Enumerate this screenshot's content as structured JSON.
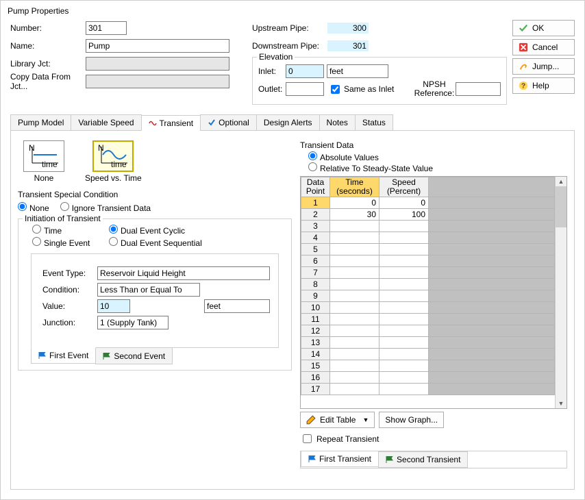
{
  "window": {
    "title": "Pump Properties"
  },
  "fields": {
    "number_label": "Number:",
    "number": "301",
    "name_label": "Name:",
    "name": "Pump",
    "library_label": "Library Jct:",
    "library": "",
    "copy_label": "Copy Data From Jct...",
    "copy": ""
  },
  "pipes": {
    "upstream_label": "Upstream Pipe:",
    "upstream": "300",
    "downstream_label": "Downstream Pipe:",
    "downstream": "301"
  },
  "elevation": {
    "title": "Elevation",
    "inlet_label": "Inlet:",
    "inlet": "0",
    "unit": "feet",
    "outlet_label": "Outlet:",
    "same_label": "Same as Inlet",
    "npsh_label": "NPSH Reference:"
  },
  "buttons": {
    "ok": "OK",
    "cancel": "Cancel",
    "jump": "Jump...",
    "help": "Help"
  },
  "tabs": {
    "pump_model": "Pump Model",
    "variable_speed": "Variable Speed",
    "transient": "Transient",
    "optional": "Optional",
    "design_alerts": "Design Alerts",
    "notes": "Notes",
    "status": "Status"
  },
  "transient_opts": {
    "none": "None",
    "speed_time": "Speed vs. Time"
  },
  "special": {
    "title": "Transient Special Condition",
    "none": "None",
    "ignore": "Ignore Transient Data"
  },
  "initiation": {
    "title": "Initiation of Transient",
    "time": "Time",
    "dual_cyclic": "Dual Event Cyclic",
    "single": "Single Event",
    "dual_seq": "Dual Event Sequential",
    "event_type_label": "Event Type:",
    "event_type": "Reservoir Liquid Height",
    "condition_label": "Condition:",
    "condition": "Less Than or Equal To",
    "value_label": "Value:",
    "value": "10",
    "value_unit": "feet",
    "junction_label": "Junction:",
    "junction": "1 (Supply Tank)",
    "first_event": "First Event",
    "second_event": "Second Event"
  },
  "tdata": {
    "title": "Transient Data",
    "abs": "Absolute Values",
    "rel": "Relative To Steady-State Value",
    "col_point": "Data Point",
    "col_time": "Time (seconds)",
    "col_speed": "Speed (Percent)",
    "rows": [
      {
        "n": "1",
        "time": "0",
        "speed": "0"
      },
      {
        "n": "2",
        "time": "30",
        "speed": "100"
      },
      {
        "n": "3"
      },
      {
        "n": "4"
      },
      {
        "n": "5"
      },
      {
        "n": "6"
      },
      {
        "n": "7"
      },
      {
        "n": "8"
      },
      {
        "n": "9"
      },
      {
        "n": "10"
      },
      {
        "n": "11"
      },
      {
        "n": "12"
      },
      {
        "n": "13"
      },
      {
        "n": "14"
      },
      {
        "n": "15"
      },
      {
        "n": "16"
      },
      {
        "n": "17"
      }
    ],
    "edit_table": "Edit Table",
    "show_graph": "Show Graph...",
    "repeat": "Repeat Transient",
    "first_transient": "First Transient",
    "second_transient": "Second Transient"
  }
}
